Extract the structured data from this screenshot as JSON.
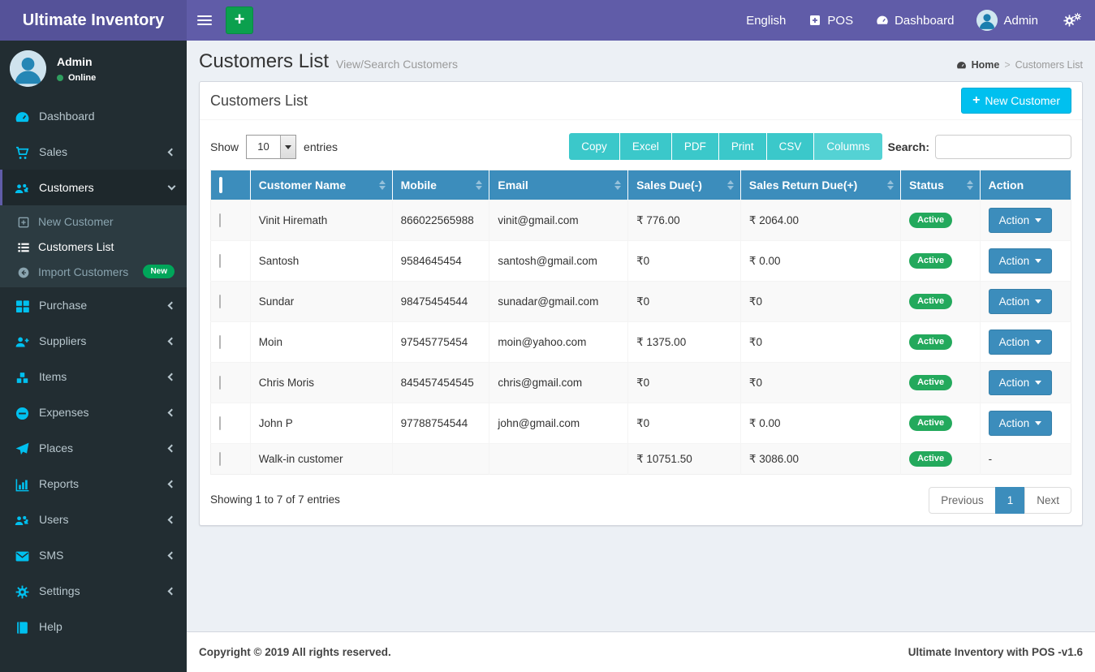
{
  "colors": {
    "navbar": "#605ca8",
    "brand_bg": "#555299",
    "sidebar_bg": "#222d32",
    "submenu_bg": "#2c3b41",
    "sidebar_icon_accent": "#00c0ef",
    "table_header": "#3c8dbc",
    "export_button": "#3bc8ca",
    "new_customer_button": "#00c0ef",
    "add_button_green": "#0ba04e",
    "active_badge_green": "#23a95c",
    "new_badge_green": "#00a65a",
    "page_bg": "#ecf0f5"
  },
  "navbar": {
    "brand": "Ultimate Inventory",
    "language": "English",
    "pos": "POS",
    "dashboard": "Dashboard",
    "user": "Admin"
  },
  "sidebar": {
    "user_name": "Admin",
    "user_status": "Online",
    "items": [
      {
        "label": "Dashboard"
      },
      {
        "label": "Sales"
      },
      {
        "label": "Customers"
      },
      {
        "label": "New Customer"
      },
      {
        "label": "Customers List"
      },
      {
        "label": "Import Customers",
        "badge": "New"
      },
      {
        "label": "Purchase"
      },
      {
        "label": "Suppliers"
      },
      {
        "label": "Items"
      },
      {
        "label": "Expenses"
      },
      {
        "label": "Places"
      },
      {
        "label": "Reports"
      },
      {
        "label": "Users"
      },
      {
        "label": "SMS"
      },
      {
        "label": "Settings"
      },
      {
        "label": "Help"
      }
    ]
  },
  "page_header": {
    "title": "Customers List",
    "subtitle": "View/Search Customers"
  },
  "breadcrumb": {
    "home": "Home",
    "separator": ">",
    "current": "Customers List"
  },
  "card": {
    "title": "Customers List",
    "new_customer_label": "New Customer",
    "plus": "+"
  },
  "controls": {
    "show_label": "Show",
    "page_length": "10",
    "entries_label": "entries",
    "search_label": "Search:",
    "export_buttons": [
      "Copy",
      "Excel",
      "PDF",
      "Print",
      "CSV",
      "Columns"
    ]
  },
  "table": {
    "headers": [
      "Customer Name",
      "Mobile",
      "Email",
      "Sales Due(-)",
      "Sales Return Due(+)",
      "Status",
      "Action"
    ],
    "rows": [
      {
        "name": "Vinit Hiremath",
        "mobile": "866022565988",
        "email": "vinit@gmail.com",
        "sales_due": "₹ 776.00",
        "sales_return_due": "₹ 2064.00",
        "status": "Active",
        "action": "Action"
      },
      {
        "name": "Santosh",
        "mobile": "9584645454",
        "email": "santosh@gmail.com",
        "sales_due": "₹0",
        "sales_return_due": "₹ 0.00",
        "status": "Active",
        "action": "Action"
      },
      {
        "name": "Sundar",
        "mobile": "98475454544",
        "email": "sunadar@gmail.com",
        "sales_due": "₹0",
        "sales_return_due": "₹0",
        "status": "Active",
        "action": "Action"
      },
      {
        "name": "Moin",
        "mobile": "97545775454",
        "email": "moin@yahoo.com",
        "sales_due": "₹ 1375.00",
        "sales_return_due": "₹0",
        "status": "Active",
        "action": "Action"
      },
      {
        "name": "Chris Moris",
        "mobile": "845457454545",
        "email": "chris@gmail.com",
        "sales_due": "₹0",
        "sales_return_due": "₹0",
        "status": "Active",
        "action": "Action"
      },
      {
        "name": "John P",
        "mobile": "97788754544",
        "email": "john@gmail.com",
        "sales_due": "₹0",
        "sales_return_due": "₹ 0.00",
        "status": "Active",
        "action": "Action"
      },
      {
        "name": "Walk-in customer",
        "mobile": "",
        "email": "",
        "sales_due": "₹ 10751.50",
        "sales_return_due": "₹ 3086.00",
        "status": "Active",
        "action": "-"
      }
    ],
    "info": "Showing 1 to 7 of 7 entries",
    "pagination": {
      "previous": "Previous",
      "page": "1",
      "next": "Next"
    }
  },
  "footer": {
    "copyright": "Copyright © 2019 All rights reserved.",
    "version": "Ultimate Inventory with POS -v1.6"
  },
  "icons": {
    "hamburger-icon": "≡",
    "add-icon": "+",
    "pos-icon": "plus-square",
    "dashboard-icon": "tachometer",
    "user-avatar": "person-circle",
    "cogs-icon": "gears",
    "home-icon": "tachometer",
    "online-dot": "●",
    "sales-icon": "shopping-cart",
    "customers-icon": "users",
    "new-customer-icon": "plus-square-o",
    "customers-list-icon": "list",
    "import-customers-icon": "arrow-circle-left",
    "purchase-icon": "th-large",
    "suppliers-icon": "user-plus",
    "items-icon": "cubes",
    "expenses-icon": "minus-circle",
    "places-icon": "paper-plane",
    "reports-icon": "bar-chart",
    "users-icon": "users",
    "sms-icon": "envelope",
    "settings-icon": "gears",
    "help-icon": "book",
    "sort-icon": "⇅",
    "caret-down-icon": "▾",
    "chevron-left-icon": "‹",
    "chevron-down-icon": "⌄"
  }
}
